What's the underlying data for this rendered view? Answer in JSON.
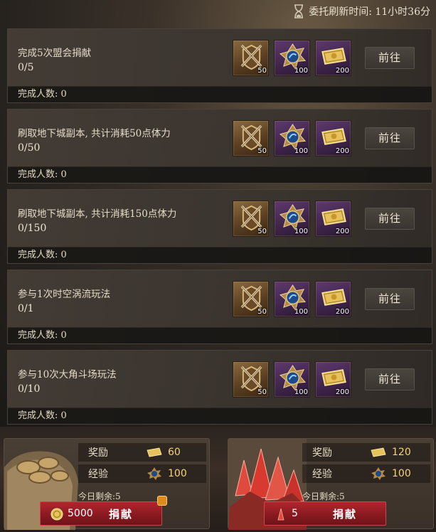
{
  "header": {
    "refresh_label": "委托刷新时间: 11小时36分"
  },
  "tasks": [
    {
      "title": "完成5次盟会捐献",
      "progress": "0/5",
      "completed_label": "完成人数: 0",
      "button": "前往",
      "rewards": [
        {
          "icon": "crossed-swords-shield-icon",
          "count": "50"
        },
        {
          "icon": "experience-emblem-icon",
          "count": "100"
        },
        {
          "icon": "gold-ticket-icon",
          "count": "200"
        }
      ]
    },
    {
      "title": "刷取地下城副本, 共计消耗50点体力",
      "progress": "0/50",
      "completed_label": "完成人数: 0",
      "button": "前往",
      "rewards": [
        {
          "icon": "crossed-swords-shield-icon",
          "count": "50"
        },
        {
          "icon": "experience-emblem-icon",
          "count": "100"
        },
        {
          "icon": "gold-ticket-icon",
          "count": "200"
        }
      ]
    },
    {
      "title": "刷取地下城副本, 共计消耗150点体力",
      "progress": "0/150",
      "completed_label": "完成人数: 0",
      "button": "前往",
      "rewards": [
        {
          "icon": "crossed-swords-shield-icon",
          "count": "50"
        },
        {
          "icon": "experience-emblem-icon",
          "count": "100"
        },
        {
          "icon": "gold-ticket-icon",
          "count": "200"
        }
      ]
    },
    {
      "title": "参与1次时空涡流玩法",
      "progress": "0/1",
      "completed_label": "完成人数: 0",
      "button": "前往",
      "rewards": [
        {
          "icon": "crossed-swords-shield-icon",
          "count": "50"
        },
        {
          "icon": "experience-emblem-icon",
          "count": "100"
        },
        {
          "icon": "gold-ticket-icon",
          "count": "200"
        }
      ]
    },
    {
      "title": "参与10次大角斗场玩法",
      "progress": "0/10",
      "completed_label": "完成人数: 0",
      "button": "前往",
      "rewards": [
        {
          "icon": "crossed-swords-shield-icon",
          "count": "50"
        },
        {
          "icon": "experience-emblem-icon",
          "count": "100"
        },
        {
          "icon": "gold-ticket-icon",
          "count": "200"
        }
      ]
    }
  ],
  "donations": [
    {
      "art": "gold-coins-sack-icon",
      "reward_label": "奖励",
      "reward_value": "60",
      "exp_label": "经验",
      "exp_value": "100",
      "remaining": "今日剩余:5",
      "cost_icon": "gold-coin-icon",
      "cost": "5000",
      "button": "捐献",
      "has_badge": true
    },
    {
      "art": "red-crystals-icon",
      "reward_label": "奖励",
      "reward_value": "120",
      "exp_label": "经验",
      "exp_value": "100",
      "remaining": "今日剩余:5",
      "cost_icon": "red-crystal-icon",
      "cost": "5",
      "button": "捐献",
      "has_badge": false
    }
  ],
  "colors": {
    "accent_gold": "#f4d27a",
    "donate_red": "#8a1a21",
    "panel_dark": "#3a3530"
  }
}
